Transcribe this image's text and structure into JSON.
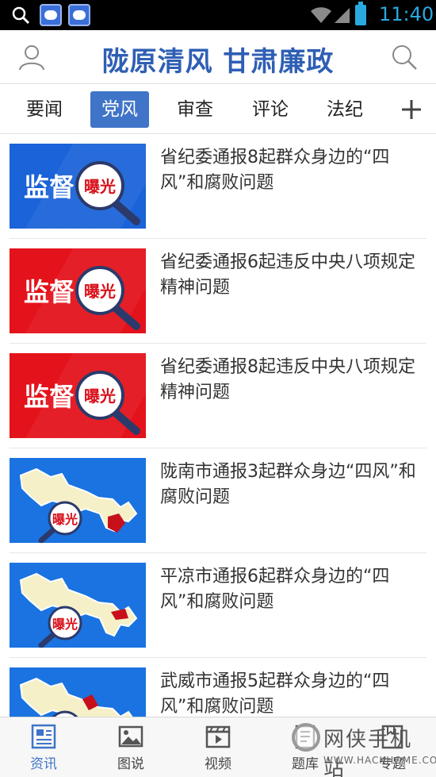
{
  "status_bar": {
    "time": "11:40"
  },
  "header": {
    "title": "陇原清风 甘肃廉政"
  },
  "tabs": [
    {
      "label": "要闻",
      "active": false
    },
    {
      "label": "党风",
      "active": true
    },
    {
      "label": "审查",
      "active": false
    },
    {
      "label": "评论",
      "active": false
    },
    {
      "label": "法纪",
      "active": false
    }
  ],
  "news": [
    {
      "title": "省纪委通报8起群众身边的“四风”和腐败问题",
      "thumb": {
        "style": "badge",
        "bg": "#1a63d8",
        "text": "监督",
        "badge": "曝光"
      }
    },
    {
      "title": "省纪委通报6起违反中央八项规定精神问题",
      "thumb": {
        "style": "badge",
        "bg": "#e4121a",
        "text": "监督",
        "badge": "曝光"
      }
    },
    {
      "title": "省纪委通报8起违反中央八项规定精神问题",
      "thumb": {
        "style": "badge",
        "bg": "#e4121a",
        "text": "监督",
        "badge": "曝光"
      }
    },
    {
      "title": "陇南市通报3起群众身边“四风”和腐败问题",
      "thumb": {
        "style": "map",
        "bg": "#1a73e0",
        "badge": "曝光"
      }
    },
    {
      "title": "平凉市通报6起群众身边的“四风”和腐败问题",
      "thumb": {
        "style": "map",
        "bg": "#1a73e0",
        "badge": "曝光"
      }
    },
    {
      "title": "武威市通报5起群众身边的“四风”和腐败问题",
      "thumb": {
        "style": "map",
        "bg": "#1a73e0",
        "badge": "曝光"
      }
    }
  ],
  "bottom_nav": [
    {
      "label": "资讯",
      "icon": "news-icon",
      "active": true
    },
    {
      "label": "图说",
      "icon": "picture-icon",
      "active": false
    },
    {
      "label": "视频",
      "icon": "video-icon",
      "active": false
    },
    {
      "label": "题库",
      "icon": "question-bank-icon",
      "active": false
    },
    {
      "label": "专题",
      "icon": "topic-icon",
      "active": false
    }
  ],
  "watermark": {
    "cn": "网侠手机站",
    "en": "WWW.HACKHOME.COM"
  },
  "colors": {
    "accent": "#3f74c8",
    "title_blue": "#2f5fb4",
    "status_time": "#29a9e0"
  }
}
